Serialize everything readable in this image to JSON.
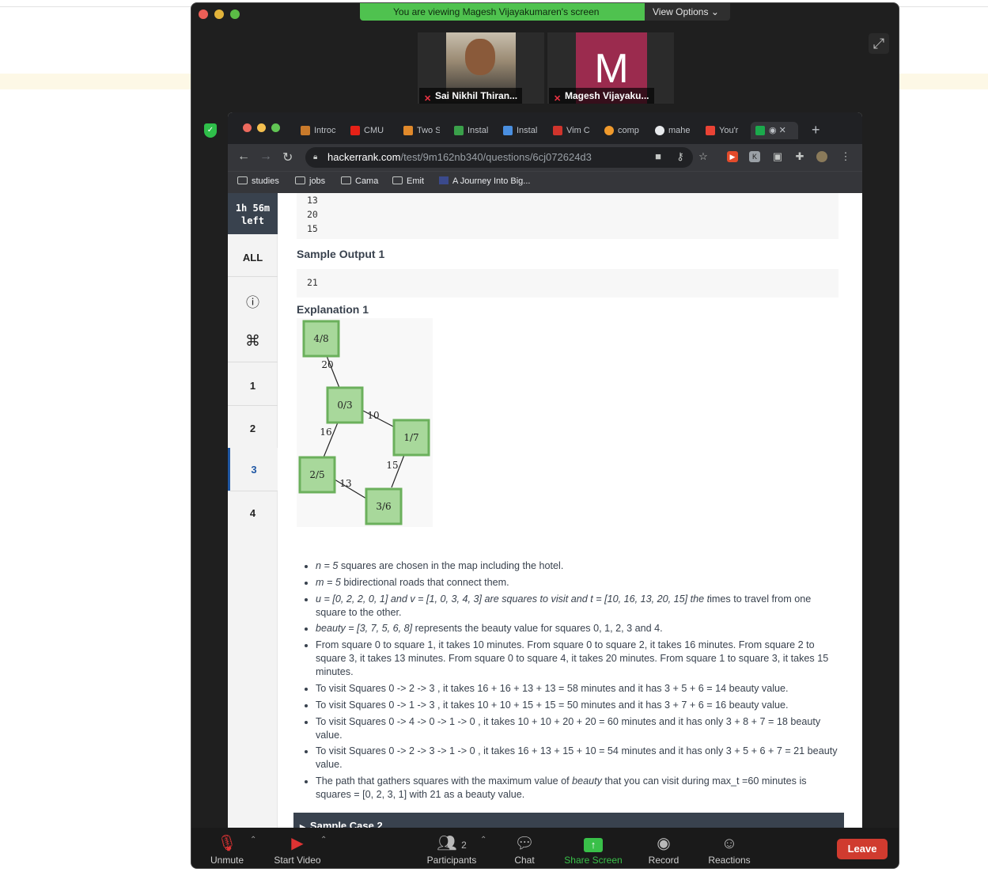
{
  "zoom": {
    "banner_text": "You are viewing Magesh Vijayakumaren's screen",
    "view_options_label": "View Options",
    "participants_tiles": [
      {
        "name": "Sai Nikhil Thiran..."
      },
      {
        "name": "Magesh Vijayaku...",
        "initial": "M",
        "avatar_color": "#9b2b4e"
      }
    ],
    "controls": {
      "unmute": "Unmute",
      "start_video": "Start Video",
      "participants": "Participants",
      "participants_count": "2",
      "chat": "Chat",
      "share_screen": "Share Screen",
      "record": "Record",
      "reactions": "Reactions",
      "leave": "Leave"
    }
  },
  "browser": {
    "tabs": [
      "Introc",
      "CMU",
      "Two S",
      "Instal",
      "Instal",
      "Vim C",
      "comp",
      "mahe",
      "You'r"
    ],
    "url_host": "hackerrank.com",
    "url_path": "/test/9m162nb340/questions/6cj072624d3",
    "bookmarks": [
      "studies",
      "jobs",
      "Cama",
      "Emit",
      "A Journey Into Big..."
    ]
  },
  "sidebar": {
    "timer_line1": "1h 56m",
    "timer_line2": "left",
    "items": [
      "ALL",
      "1",
      "2",
      "3",
      "4"
    ],
    "active_item": "3"
  },
  "problem": {
    "input_lines": [
      "13",
      "20",
      "15"
    ],
    "sample_output_title": "Sample Output 1",
    "sample_output_value": "21",
    "explanation_title": "Explanation 1",
    "graph": {
      "nodes": [
        "4/8",
        "0/3",
        "1/7",
        "2/5",
        "3/6"
      ],
      "edge_labels": [
        "20",
        "10",
        "16",
        "15",
        "13"
      ]
    },
    "bullets": [
      {
        "it": "n = 5",
        "rest": " squares are chosen in the map including the hotel."
      },
      {
        "it": "m = 5",
        "rest": " bidirectional roads that connect them."
      },
      {
        "it": "u = [0, 2, 2, 0, 1] and v = [1, 0, 3, 4, 3] are squares to visit and t = [10, 16, 13, 20, 15] the t",
        "rest": "imes to travel from one square to the other."
      },
      {
        "it": "beauty = [3, 7, 5, 6, 8]",
        "rest": "  represents the beauty value for squares 0, 1, 2, 3 and 4."
      },
      {
        "it": "",
        "rest": "From square 0 to square 1, it takes 10 minutes. From square 0 to square 2, it takes 16 minutes. From square 2 to square 3, it takes 13 minutes. From square 0 to square 4, it takes 20 minutes.  From square 1 to square 3, it takes 15 minutes."
      },
      {
        "it": "",
        "rest": "To visit Squares 0  -> 2 -> 3 , it takes 16 + 16 + 13 + 13 = 58 minutes and it has 3 + 5 + 6 = 14 beauty value."
      },
      {
        "it": "",
        "rest": "To visit Squares 0  -> 1 -> 3 , it takes 10 + 10 + 15 + 15 = 50 minutes and it has 3 + 7 + 6 = 16 beauty value."
      },
      {
        "it": "",
        "rest": "To visit Squares 0  -> 4 -> 0  -> 1 -> 0  , it takes 10 + 10 + 20 + 20  = 60 minutes and it has only 3 + 8 + 7 = 18 beauty value."
      },
      {
        "it": "",
        "rest": "To visit Squares 0  -> 2 -> 3  -> 1 -> 0  , it takes 16 + 13 + 15 + 10  = 54 minutes and it has only 3 + 5 + 6 + 7 = 21 beauty value."
      }
    ],
    "last_bullet": {
      "pre": "The path that gathers squares with the maximum value of ",
      "it": "beauty",
      "post": " that you can visit during max_t =60  minutes is squares = [0, 2, 3, 1] with 21  as a beauty value."
    },
    "next_section": "Sample Case 2"
  }
}
